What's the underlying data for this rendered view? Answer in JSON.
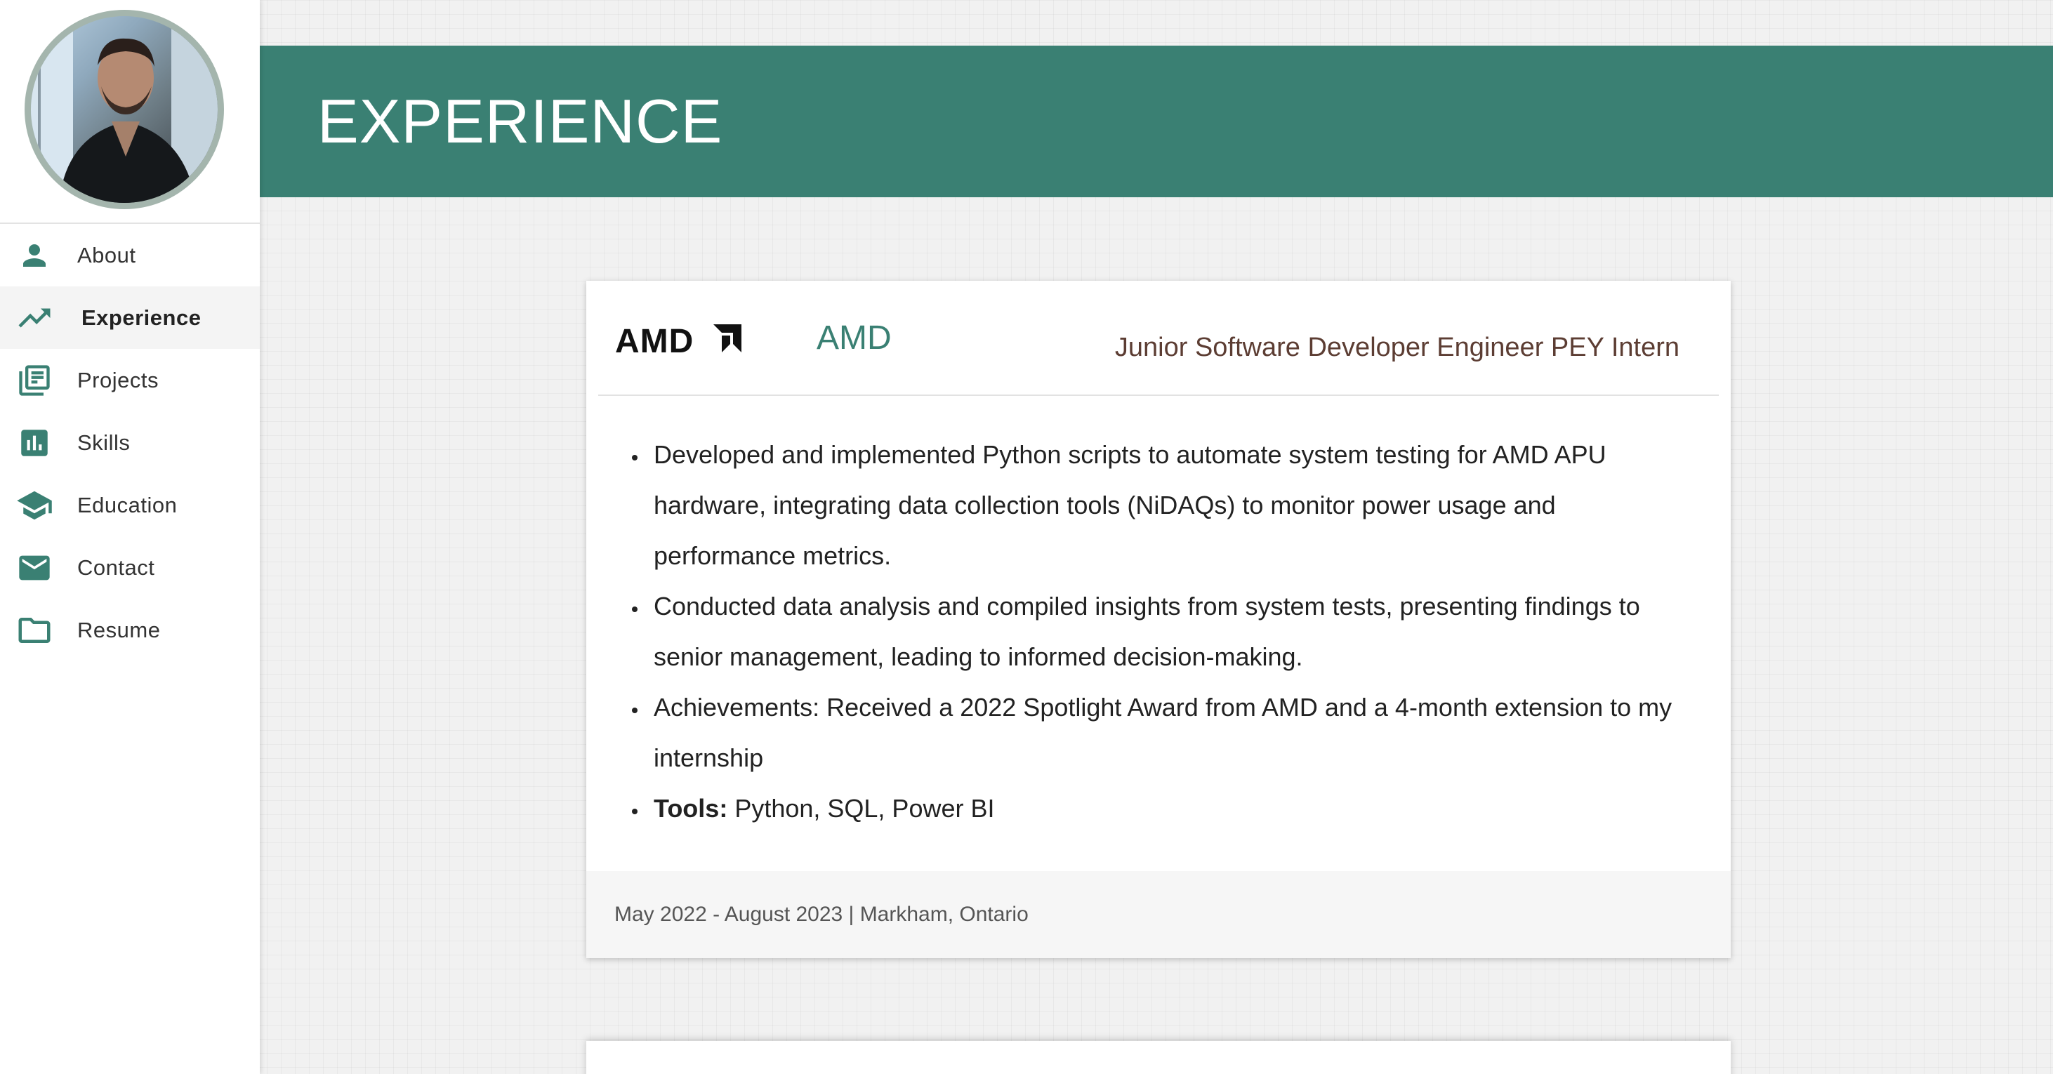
{
  "sidebar": {
    "items": [
      {
        "label": "About",
        "icon": "person-icon"
      },
      {
        "label": "Experience",
        "icon": "trending-up-icon",
        "active": true
      },
      {
        "label": "Projects",
        "icon": "library-books-icon"
      },
      {
        "label": "Skills",
        "icon": "bar-chart-icon"
      },
      {
        "label": "Education",
        "icon": "school-icon"
      },
      {
        "label": "Contact",
        "icon": "mail-icon"
      },
      {
        "label": "Resume",
        "icon": "folder-icon"
      }
    ]
  },
  "header": {
    "title": "EXPERIENCE"
  },
  "experience": {
    "company": "AMD",
    "logo_text": "AMD",
    "role": "Junior Software Developer Engineer PEY Intern",
    "bullets": [
      "Developed and implemented Python scripts to automate system testing for AMD APU hardware, integrating data collection tools (NiDAQs) to monitor power usage and performance metrics.",
      "Conducted data analysis and compiled insights from system tests, presenting findings to senior management, leading to informed decision-making.",
      "Achievements: Received a 2022 Spotlight Award from AMD and a 4-month extension to my internship"
    ],
    "tools_label": "Tools:",
    "tools_value": " Python, SQL, Power BI",
    "footer": "May 2022 - August 2023 | Markham, Ontario"
  },
  "colors": {
    "accent": "#3a8073",
    "role_text": "#5c3d33",
    "avatar_ring": "#a4b5ad"
  }
}
